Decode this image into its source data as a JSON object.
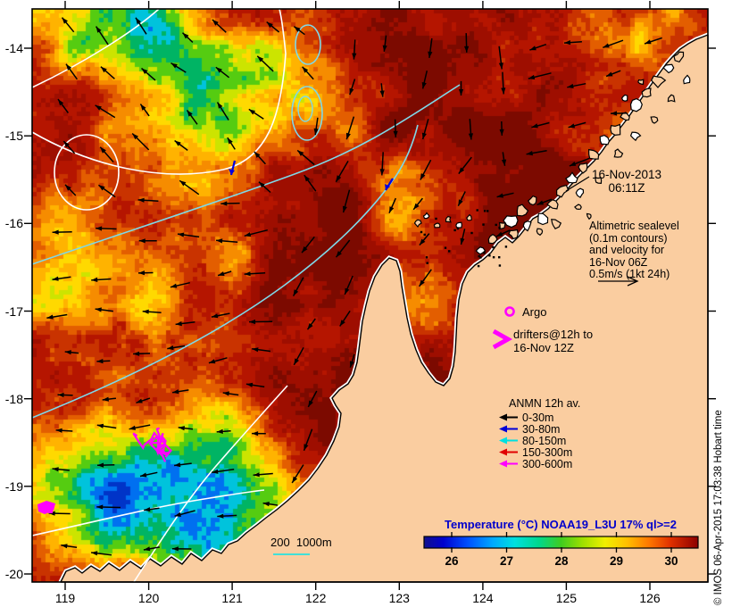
{
  "datetime": {
    "line1": "16-Nov-2013",
    "line2": "06:11Z"
  },
  "altimetric_lines": [
    "Altimetric sealevel",
    "(0.1m contours)",
    "and velocity for",
    "16-Nov 06Z",
    "0.5m/s (1kt 24h)"
  ],
  "argo_label": "Argo",
  "drifters": {
    "line1": "drifters@12h to",
    "line2": "16-Nov 12Z"
  },
  "anmn": {
    "title": "ANMN 12h av.",
    "items": [
      {
        "label": "0-30m",
        "color": "#000000"
      },
      {
        "label": "30-80m",
        "color": "#0000D8"
      },
      {
        "label": "80-150m",
        "color": "#00E0E0"
      },
      {
        "label": "150-300m",
        "color": "#E00000"
      },
      {
        "label": "300-600m",
        "color": "#FF00FF"
      }
    ]
  },
  "depth_legend": "200  1000m",
  "colorbar": {
    "title": "Temperature (°C) NOAA19_L3U 17% ql>=2",
    "title_color": "#0000CC",
    "tick_labels": [
      "26",
      "27",
      "28",
      "29",
      "30"
    ]
  },
  "watermark": "© IMOS 06-Apr-2015 17:03:38  Hobart time",
  "axes": {
    "x_tick_labels": [
      "119",
      "120",
      "121",
      "122",
      "123",
      "124",
      "125",
      "126"
    ],
    "y_tick_labels": [
      "-14",
      "-15",
      "-16",
      "-17",
      "-18",
      "-19",
      "-20"
    ]
  },
  "colors": {
    "land": "#FACDA0",
    "ocean_base": "#AD1200",
    "contour_white": "#FFFFFF",
    "contour_cyan": "#7FD8E8",
    "bathy_cyan": "#40E0D8",
    "magenta": "#FF00FF",
    "arrow_black": "#000000"
  },
  "chart_data": {
    "type": "heatmap",
    "title": "Temperature (°C) NOAA19_L3U 17% ql>=2",
    "x_ticks": [
      119,
      120,
      121,
      122,
      123,
      124,
      125,
      126
    ],
    "y_ticks": [
      -14,
      -15,
      -16,
      -17,
      -18,
      -19,
      -20
    ],
    "colorbar_ticks": [
      26,
      27,
      28,
      29,
      30
    ],
    "colorbar_range": [
      25.5,
      30.5
    ]
  }
}
